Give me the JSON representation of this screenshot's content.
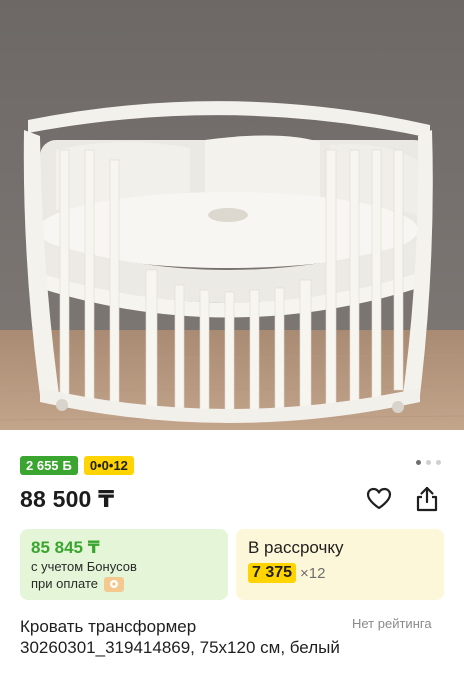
{
  "product": {
    "image_alt": "Oval white baby crib with white bedding",
    "bonus_badge": "2 655",
    "bonus_badge_suffix": "Б",
    "installment_badge": "0•0•12",
    "price": "88 500 ₸",
    "bonus_card": {
      "amount": "85 845 ₸",
      "line1": "с учетом Бонусов",
      "line2": "при оплате"
    },
    "installment_card": {
      "title": "В рассрочку",
      "monthly": "7 375",
      "multiplier": "×12"
    },
    "title": "Кровать трансформер 30260301_319414869, 75x120 см, белый",
    "rating": "Нет рейтинга"
  },
  "icons": {
    "favorite": "heart-icon",
    "share": "share-icon",
    "kaspi": "kaspi-logo-icon"
  },
  "colors": {
    "bonus_green": "#3aa52f",
    "installment_yellow": "#ffd400",
    "bonus_card_bg": "#e4f5d8",
    "installment_card_bg": "#fdf7d9"
  }
}
